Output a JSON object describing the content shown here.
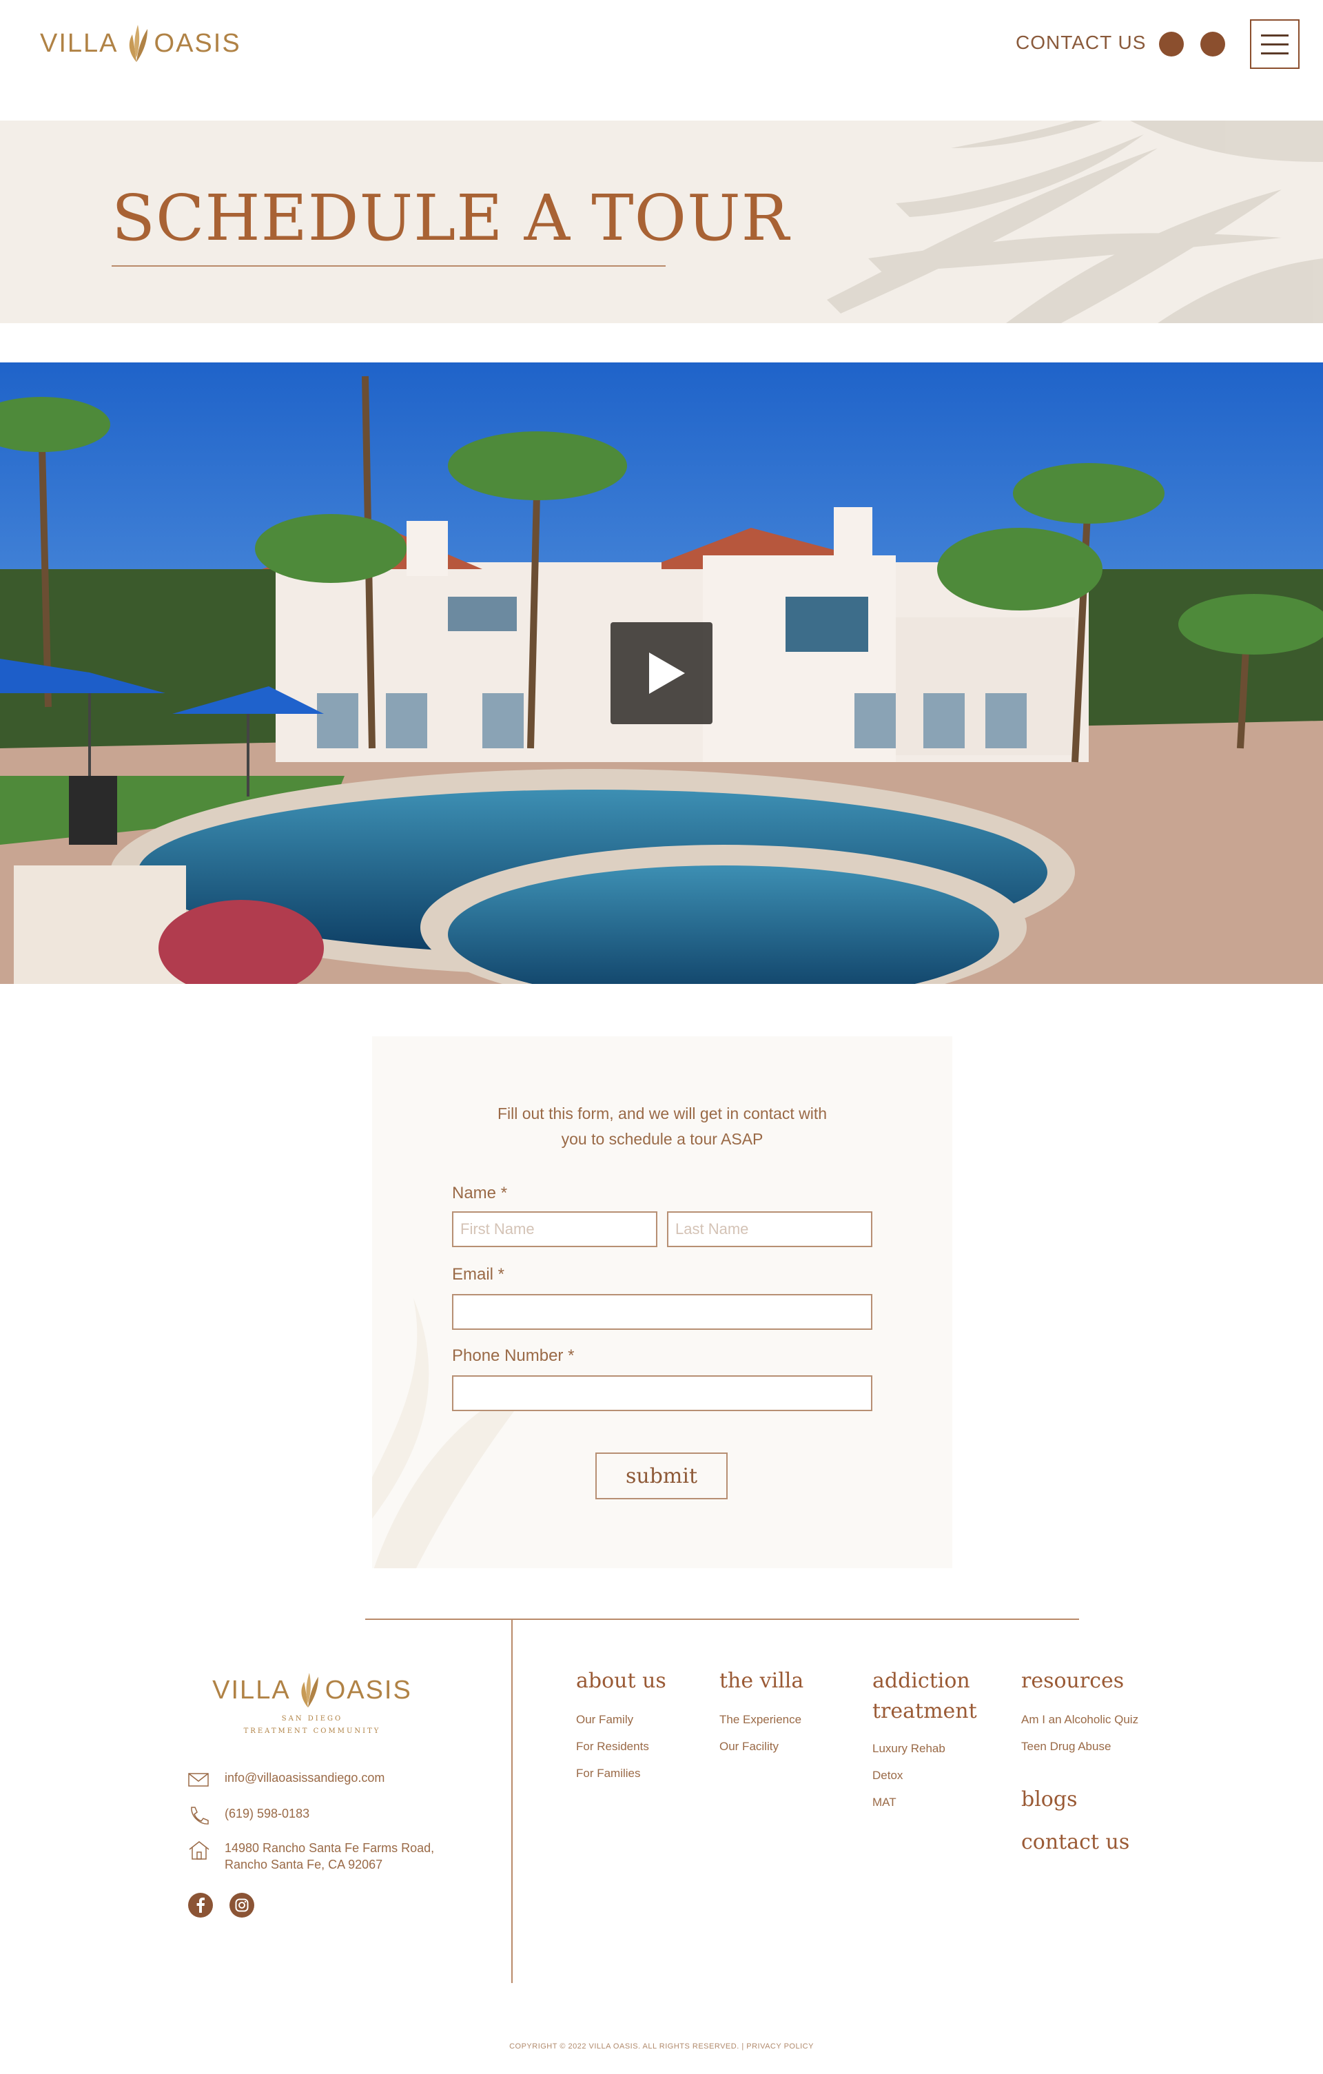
{
  "brand": {
    "name_left": "VILLA",
    "name_right": "OASIS",
    "tagline_line1": "SAN DIEGO",
    "tagline_line2": "TREATMENT COMMUNITY",
    "color_primary": "#a86234",
    "color_gold": "#b08245"
  },
  "header": {
    "contact_label": "CONTACT US",
    "social_icons": [
      "facebook-icon",
      "instagram-icon"
    ],
    "menu_icon": "hamburger-menu-icon"
  },
  "hero": {
    "title": "SCHEDULE A TOUR"
  },
  "video": {
    "play_icon": "play-icon"
  },
  "form": {
    "intro_line1": "Fill out this form, and we will get in contact with",
    "intro_line2": "you to schedule a tour ASAP",
    "name_label": "Name *",
    "first_name_placeholder": "First Name",
    "last_name_placeholder": "Last Name",
    "first_name_value": "",
    "last_name_value": "",
    "email_label": "Email *",
    "email_value": "",
    "phone_label": "Phone Number *",
    "phone_value": "",
    "submit_label": "submit"
  },
  "footer": {
    "email": "info@villaoasissandiego.com",
    "phone": "(619) 598-0183",
    "address_line1": "14980 Rancho Santa Fe Farms Road,",
    "address_line2": "Rancho Santa Fe, CA 92067",
    "columns": {
      "about": {
        "title": "about us",
        "links": [
          "Our Family",
          "For Residents",
          "For Families"
        ]
      },
      "villa": {
        "title": "the villa",
        "links": [
          "The Experience",
          "Our Facility"
        ]
      },
      "addiction": {
        "title_line1": "addiction",
        "title_line2": "treatment",
        "links": [
          "Luxury Rehab",
          "Detox",
          "MAT"
        ]
      },
      "resources": {
        "title": "resources",
        "links": [
          "Am I an Alcoholic Quiz",
          "Teen Drug Abuse"
        ]
      },
      "blogs": "blogs",
      "contact": "contact us"
    },
    "copyright": "COPYRIGHT © 2022 VILLA OASIS. ALL RIGHTS RESERVED. | PRIVACY POLICY"
  }
}
